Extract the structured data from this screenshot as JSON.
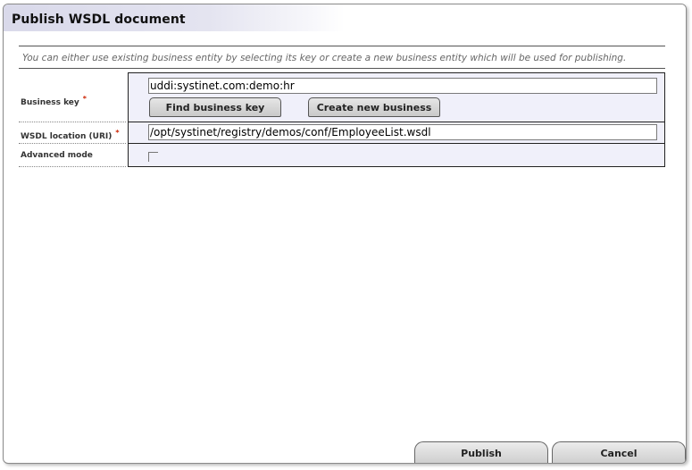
{
  "dialog": {
    "title": "Publish WSDL document",
    "hint": "You can either use existing business entity by selecting its key or create a new business entity which will be used for publishing."
  },
  "form": {
    "business_key": {
      "label": "Business key",
      "required_mark": "*",
      "value": "uddi:systinet.com:demo:hr",
      "find_button": "Find business key",
      "create_button": "Create new business"
    },
    "wsdl_location": {
      "label": "WSDL location (URI)",
      "required_mark": "*",
      "value": "/opt/systinet/registry/demos/conf/EmployeeList.wsdl"
    },
    "advanced_mode": {
      "label": "Advanced mode",
      "checked": false
    }
  },
  "footer": {
    "publish_button": "Publish",
    "cancel_button": "Cancel"
  }
}
